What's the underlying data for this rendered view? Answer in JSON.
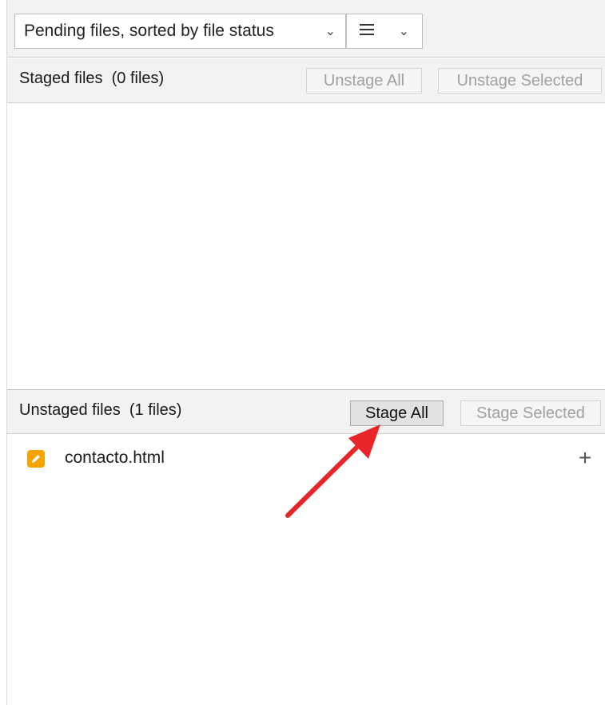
{
  "toolbar": {
    "view_select": {
      "value": "Pending files, sorted by file status",
      "chevron_icon": "chevron-down-icon"
    },
    "layout_select": {
      "icon": "list-icon",
      "chevron_icon": "chevron-down-icon"
    }
  },
  "staged": {
    "title": "Staged files",
    "count": "(0 files)",
    "unstage_all_label": "Unstage All",
    "unstage_selected_label": "Unstage Selected"
  },
  "unstaged": {
    "title": "Unstaged files",
    "count": "(1 files)",
    "stage_all_label": "Stage All",
    "stage_selected_label": "Stage Selected",
    "files": [
      {
        "name": "contacto.html",
        "status_icon": "modified-file-icon",
        "action_icon": "plus-icon",
        "status_color": "#f5a300"
      }
    ]
  },
  "annotation": {
    "arrow_color": "#e8262a",
    "arrow_icon": "red-arrow-annotation"
  }
}
